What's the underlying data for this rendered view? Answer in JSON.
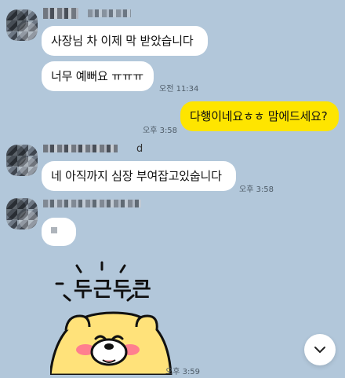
{
  "messages": [
    {
      "text": "사장님 차 이제 막 받았습니다"
    },
    {
      "text": "너무 예뻐요 ㅠㅠㅠ",
      "time": "오전 11:34"
    },
    {
      "text": "다행이네요ㅎㅎ 맘에드세요?",
      "time": "오후 3:58"
    },
    {
      "text": "네 아직까지 심장 부여잡고있숩니다",
      "time": "오후 3:58"
    }
  ],
  "sender_name_suffix": "d",
  "sticker": {
    "text": "두근두근",
    "time": "오후 3:59"
  },
  "icons": {
    "scroll": "chevron-down-icon"
  }
}
